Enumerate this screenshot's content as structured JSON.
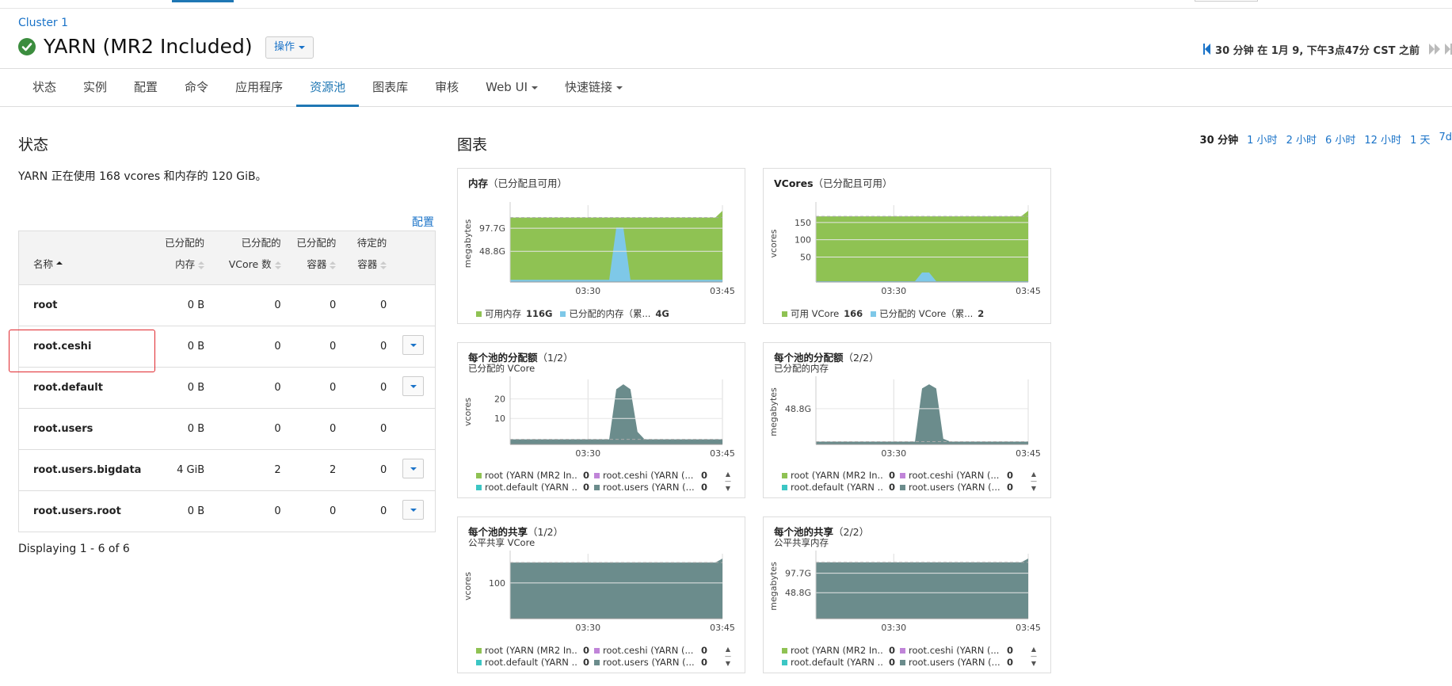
{
  "header": {
    "cluster_link": "Cluster 1",
    "service_title": "YARN (MR2 Included)",
    "action_button": "操作",
    "time_range_text": "30 分钟 在 1月 9, 下午3点47分 CST 之前"
  },
  "tabs": [
    {
      "label": "状态"
    },
    {
      "label": "实例"
    },
    {
      "label": "配置"
    },
    {
      "label": "命令"
    },
    {
      "label": "应用程序"
    },
    {
      "label": "资源池",
      "active": true
    },
    {
      "label": "图表库"
    },
    {
      "label": "审核"
    },
    {
      "label": "Web UI",
      "dropdown": true
    },
    {
      "label": "快速链接",
      "dropdown": true
    }
  ],
  "status_section": {
    "title": "状态",
    "summary": "YARN 正在使用 168 vcores 和内存的 120 GiB。",
    "config_link": "配置",
    "table": {
      "columns": [
        {
          "line1": "",
          "line2": "名称",
          "sorted": "asc"
        },
        {
          "line1": "已分配的",
          "line2": "内存"
        },
        {
          "line1": "已分配的",
          "line2": "VCore 数"
        },
        {
          "line1": "已分配的",
          "line2": "容器"
        },
        {
          "line1": "待定的",
          "line2": "容器"
        }
      ],
      "rows": [
        {
          "name": "root",
          "memory": "0 B",
          "vcores": "0",
          "containers": "0",
          "pending": "0",
          "menu": false
        },
        {
          "name": "root.ceshi",
          "memory": "0 B",
          "vcores": "0",
          "containers": "0",
          "pending": "0",
          "menu": true,
          "highlighted": true
        },
        {
          "name": "root.default",
          "memory": "0 B",
          "vcores": "0",
          "containers": "0",
          "pending": "0",
          "menu": true
        },
        {
          "name": "root.users",
          "memory": "0 B",
          "vcores": "0",
          "containers": "0",
          "pending": "0",
          "menu": false
        },
        {
          "name": "root.users.bigdata",
          "memory": "4 GiB",
          "vcores": "2",
          "containers": "2",
          "pending": "0",
          "menu": true
        },
        {
          "name": "root.users.root",
          "memory": "0 B",
          "vcores": "0",
          "containers": "0",
          "pending": "0",
          "menu": true
        }
      ]
    },
    "displaying": "Displaying 1 - 6 of 6"
  },
  "charts_section": {
    "title": "图表",
    "ranges": [
      {
        "label": "30 分钟",
        "current": true
      },
      {
        "label": "1 小时"
      },
      {
        "label": "2 小时"
      },
      {
        "label": "6 小时"
      },
      {
        "label": "12 小时"
      },
      {
        "label": "1 天"
      },
      {
        "label": "7d"
      }
    ]
  },
  "colors": {
    "accent": "#1f77b4",
    "available_green": "#8fc253",
    "allocated_blue": "#7ec8e8",
    "pool_green": "#4fb57f",
    "highlight_red": "#e0282e"
  },
  "chart_data": [
    {
      "type": "area",
      "title": "内存",
      "title_paren": "（已分配且可用）",
      "subtitle": "",
      "ylabel": "megabytes",
      "y_ticks": [
        "97.7G",
        "48.8G"
      ],
      "x_ticks": [
        "03:30",
        "03:45"
      ],
      "series": [
        {
          "name": "可用内存",
          "legend_value": "116G",
          "color": "#8fc253",
          "values": [
            116,
            116,
            116,
            116,
            116,
            116,
            116,
            116,
            116,
            116,
            116,
            116,
            116,
            116,
            116,
            116,
            116,
            116,
            116,
            116,
            116,
            116,
            116,
            116,
            116,
            116,
            116,
            116,
            116,
            116,
            128
          ]
        },
        {
          "name": "已分配的内存（累...",
          "legend_value": "4G",
          "color": "#7ec8e8",
          "values": [
            4,
            4,
            4,
            4,
            4,
            4,
            4,
            4,
            4,
            4,
            4,
            4,
            4,
            4,
            4,
            98,
            98,
            4,
            4,
            4,
            4,
            4,
            4,
            4,
            4,
            4,
            4,
            4,
            4,
            4,
            4
          ]
        }
      ]
    },
    {
      "type": "area",
      "title": "VCores",
      "title_paren": "（已分配且可用）",
      "subtitle": "",
      "ylabel": "vcores",
      "y_ticks": [
        "150",
        "100",
        "50"
      ],
      "x_ticks": [
        "03:30",
        "03:45"
      ],
      "series": [
        {
          "name": "可用 VCore",
          "legend_value": "166",
          "color": "#8fc253",
          "values": [
            166,
            166,
            166,
            166,
            166,
            166,
            166,
            166,
            166,
            166,
            166,
            166,
            166,
            166,
            166,
            166,
            166,
            166,
            166,
            166,
            166,
            166,
            166,
            166,
            166,
            166,
            166,
            166,
            166,
            166,
            180
          ]
        },
        {
          "name": "已分配的 VCore（累...",
          "legend_value": "2",
          "color": "#7ec8e8",
          "values": [
            2,
            2,
            2,
            2,
            2,
            2,
            2,
            2,
            2,
            2,
            2,
            2,
            2,
            2,
            2,
            24,
            24,
            2,
            2,
            2,
            2,
            2,
            2,
            2,
            2,
            2,
            2,
            2,
            2,
            2,
            2
          ]
        }
      ]
    },
    {
      "type": "area",
      "title": "每个池的分配额",
      "title_paren": "（1/2）",
      "subtitle": "已分配的 VCore",
      "ylabel": "vcores",
      "y_ticks": [
        "20",
        "10"
      ],
      "x_ticks": [
        "03:30",
        "03:45"
      ],
      "series": [
        {
          "name": "root (YARN (MR2 In...",
          "legend_value": "0",
          "color": "#8fc253",
          "values": [
            0
          ]
        },
        {
          "name": "root.ceshi (YARN (...",
          "legend_value": "0",
          "color": "#c084d8",
          "values": [
            0
          ]
        },
        {
          "name": "root.default (YARN ...",
          "legend_value": "0",
          "color": "#3cc6c4",
          "values": [
            0
          ]
        },
        {
          "name": "root.users (YARN (...",
          "legend_value": "0",
          "color": "#6b8c8c",
          "values": [
            2,
            2,
            2,
            2,
            2,
            2,
            2,
            2,
            2,
            2,
            2,
            2,
            2,
            2,
            2,
            22,
            24,
            22,
            5,
            2,
            2,
            2,
            2,
            2,
            2,
            2,
            2,
            2,
            2,
            2,
            2
          ]
        }
      ]
    },
    {
      "type": "area",
      "title": "每个池的分配额",
      "title_paren": "（2/2）",
      "subtitle": "已分配的内存",
      "ylabel": "megabytes",
      "y_ticks": [
        "48.8G"
      ],
      "x_ticks": [
        "03:30",
        "03:45"
      ],
      "series": [
        {
          "name": "root (YARN (MR2 In...",
          "legend_value": "0",
          "color": "#8fc253",
          "values": [
            0
          ]
        },
        {
          "name": "root.ceshi (YARN (...",
          "legend_value": "0",
          "color": "#c084d8",
          "values": [
            0
          ]
        },
        {
          "name": "root.default (YARN ...",
          "legend_value": "0",
          "color": "#3cc6c4",
          "values": [
            0
          ]
        },
        {
          "name": "root.users (YARN (...",
          "legend_value": "0",
          "color": "#6b8c8c",
          "values": [
            4,
            4,
            4,
            4,
            4,
            4,
            4,
            4,
            4,
            4,
            4,
            4,
            4,
            4,
            4,
            80,
            86,
            80,
            8,
            4,
            4,
            4,
            4,
            4,
            4,
            4,
            4,
            4,
            4,
            4,
            4
          ]
        }
      ]
    },
    {
      "type": "area",
      "title": "每个池的共享",
      "title_paren": "（1/2）",
      "subtitle": "公平共享 VCore",
      "ylabel": "vcores",
      "y_ticks": [
        "100"
      ],
      "x_ticks": [
        "03:30",
        "03:45"
      ],
      "series": [
        {
          "name": "root (YARN (MR2 In...",
          "legend_value": "0",
          "color": "#8fc253",
          "values": [
            0
          ]
        },
        {
          "name": "root.ceshi (YARN (...",
          "legend_value": "0",
          "color": "#c084d8",
          "values": [
            0
          ]
        },
        {
          "name": "root.default (YARN ...",
          "legend_value": "0",
          "color": "#3cc6c4",
          "values": [
            0
          ]
        },
        {
          "name": "root.users (YARN (...",
          "legend_value": "0",
          "color": "#6b8c8c",
          "values": [
            168,
            168,
            168,
            168,
            168,
            168,
            168,
            168,
            168,
            168,
            168,
            168,
            168,
            168,
            168,
            168,
            168,
            168,
            168,
            168,
            168,
            168,
            168,
            168,
            168,
            168,
            168,
            168,
            168,
            168,
            180
          ]
        }
      ]
    },
    {
      "type": "area",
      "title": "每个池的共享",
      "title_paren": "（2/2）",
      "subtitle": "公平共享内存",
      "ylabel": "megabytes",
      "y_ticks": [
        "97.7G",
        "48.8G"
      ],
      "x_ticks": [
        "03:30",
        "03:45"
      ],
      "series": [
        {
          "name": "root (YARN (MR2 In...",
          "legend_value": "0",
          "color": "#8fc253",
          "values": [
            0
          ]
        },
        {
          "name": "root.ceshi (YARN (...",
          "legend_value": "0",
          "color": "#c084d8",
          "values": [
            0
          ]
        },
        {
          "name": "root.default (YARN ...",
          "legend_value": "0",
          "color": "#3cc6c4",
          "values": [
            0
          ]
        },
        {
          "name": "root.users (YARN (...",
          "legend_value": "0",
          "color": "#6b8c8c",
          "values": [
            120,
            120,
            120,
            120,
            120,
            120,
            120,
            120,
            120,
            120,
            120,
            120,
            120,
            120,
            120,
            120,
            120,
            120,
            120,
            120,
            120,
            120,
            120,
            120,
            120,
            120,
            120,
            120,
            120,
            120,
            128
          ]
        }
      ]
    }
  ]
}
